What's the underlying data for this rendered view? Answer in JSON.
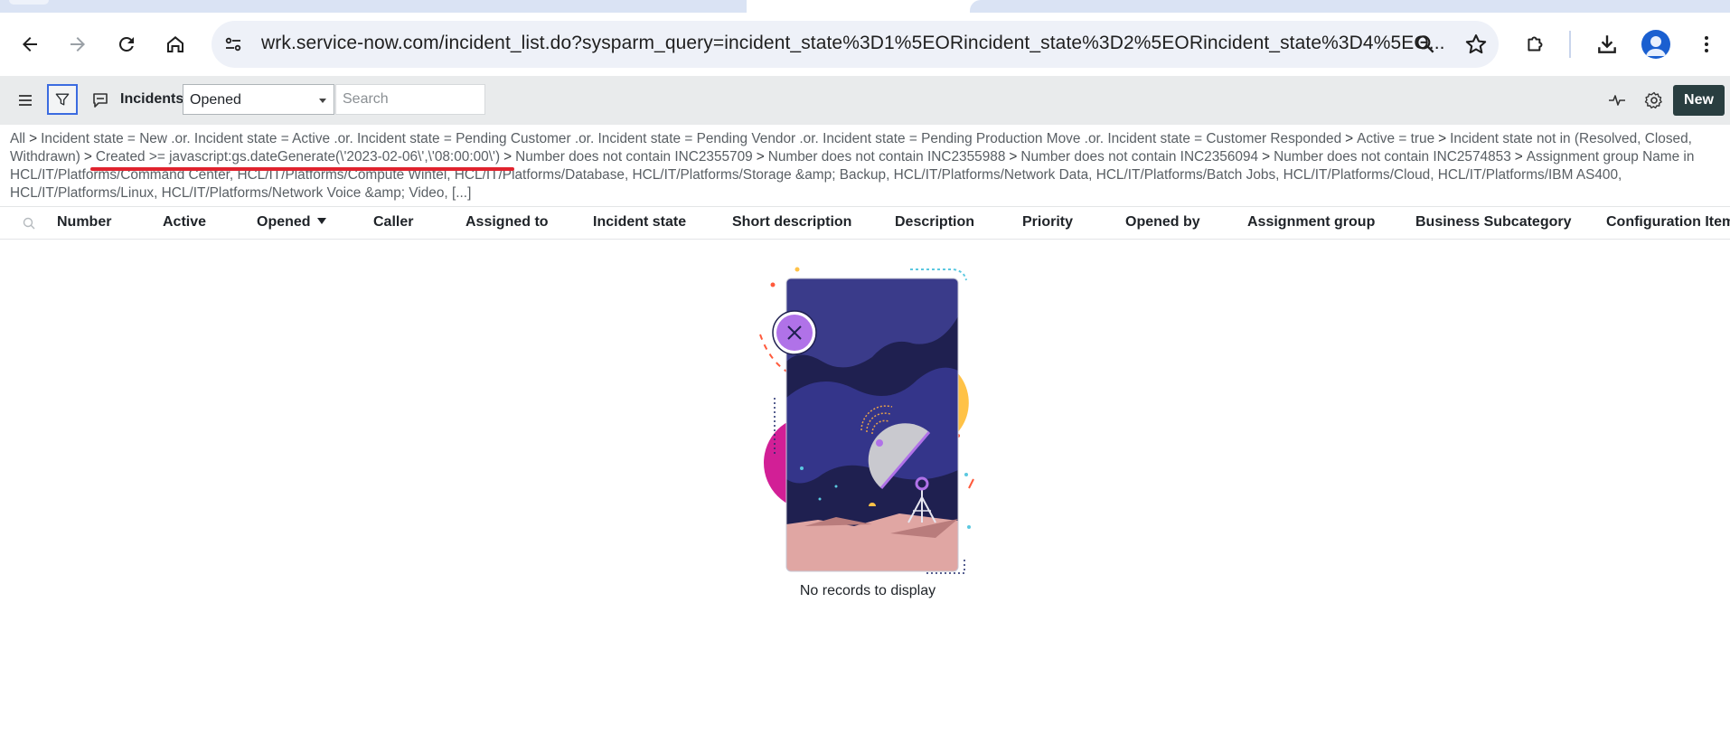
{
  "browser": {
    "url": "wrk.service-now.com/incident_list.do?sysparm_query=incident_state%3D1%5EORincident_state%3D2%5EORincident_state%3D4%5EO..."
  },
  "list": {
    "title": "Incidents",
    "filter_select": "Opened",
    "search_placeholder": "Search",
    "new_label": "New"
  },
  "breadcrumb": {
    "items": [
      "All",
      "Incident state = New .or. Incident state = Active .or. Incident state = Pending Customer .or. Incident state = Pending Vendor .or. Incident state = Pending Production Move .or. Incident state = Customer Responded",
      "Active = true",
      "Incident state not in (Resolved, Closed, Withdrawn)",
      "Created >= javascript:gs.dateGenerate(\\'2023-02-06\\',\\'08:00:00\\')",
      "Number does not contain INC2355709",
      "Number does not contain INC2355988",
      "Number does not contain INC2356094",
      "Number does not contain INC2574853",
      "Assignment group Name in HCL/IT/Platforms/Command Center, HCL/IT/Platforms/Compute Wintel, HCL/IT/Platforms/Database, HCL/IT/Platforms/Storage &amp; Backup, HCL/IT/Platforms/Network Data, HCL/IT/Platforms/Batch Jobs, HCL/IT/Platforms/Cloud, HCL/IT/Platforms/IBM AS400, HCL/IT/Platforms/Linux, HCL/IT/Platforms/Network Voice &amp; Video, [...]"
    ]
  },
  "columns": [
    "Number",
    "Active",
    "Opened",
    "Caller",
    "Assigned to",
    "Incident state",
    "Short description",
    "Description",
    "Priority",
    "Opened by",
    "Assignment group",
    "Business Subcategory",
    "Configuration Item"
  ],
  "sorted_column": "Opened",
  "empty_message": "No records to display",
  "colors": {
    "accent": "#293e40",
    "header_bg": "#e9ebec",
    "filter_focus": "#3b6be0",
    "annotation_red": "#e0232e"
  }
}
